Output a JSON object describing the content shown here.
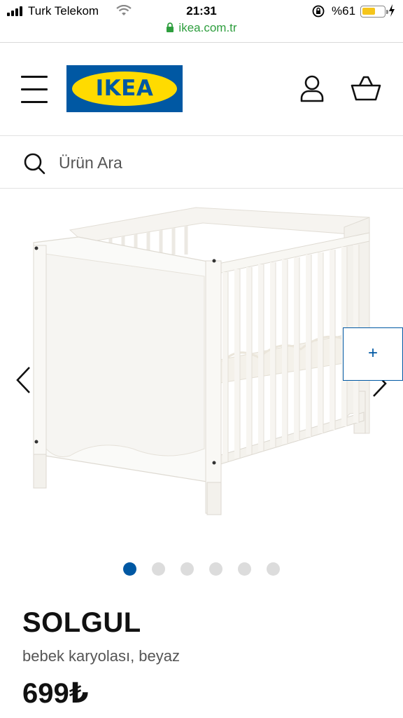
{
  "status_bar": {
    "carrier": "Turk Telekom",
    "time": "21:31",
    "battery_percent": "%61",
    "battery_level": 0.61,
    "battery_color": "#f5c51b"
  },
  "browser": {
    "url": "ikea.com.tr",
    "url_color": "#2e9e3e"
  },
  "header": {
    "logo_text": "IKEA",
    "brand_blue": "#0058a3",
    "brand_yellow": "#ffdb00",
    "icons": [
      "menu-icon",
      "user-icon",
      "basket-icon"
    ]
  },
  "search": {
    "placeholder": "Ürün Ara",
    "icon": "search-icon"
  },
  "gallery": {
    "zoom_label": "+",
    "image_count": 6,
    "active_index": 0,
    "icons": [
      "chevron-left-icon",
      "chevron-right-icon"
    ]
  },
  "product": {
    "name": "SOLGUL",
    "description": "bebek karyolası, beyaz",
    "price": "699₺"
  }
}
